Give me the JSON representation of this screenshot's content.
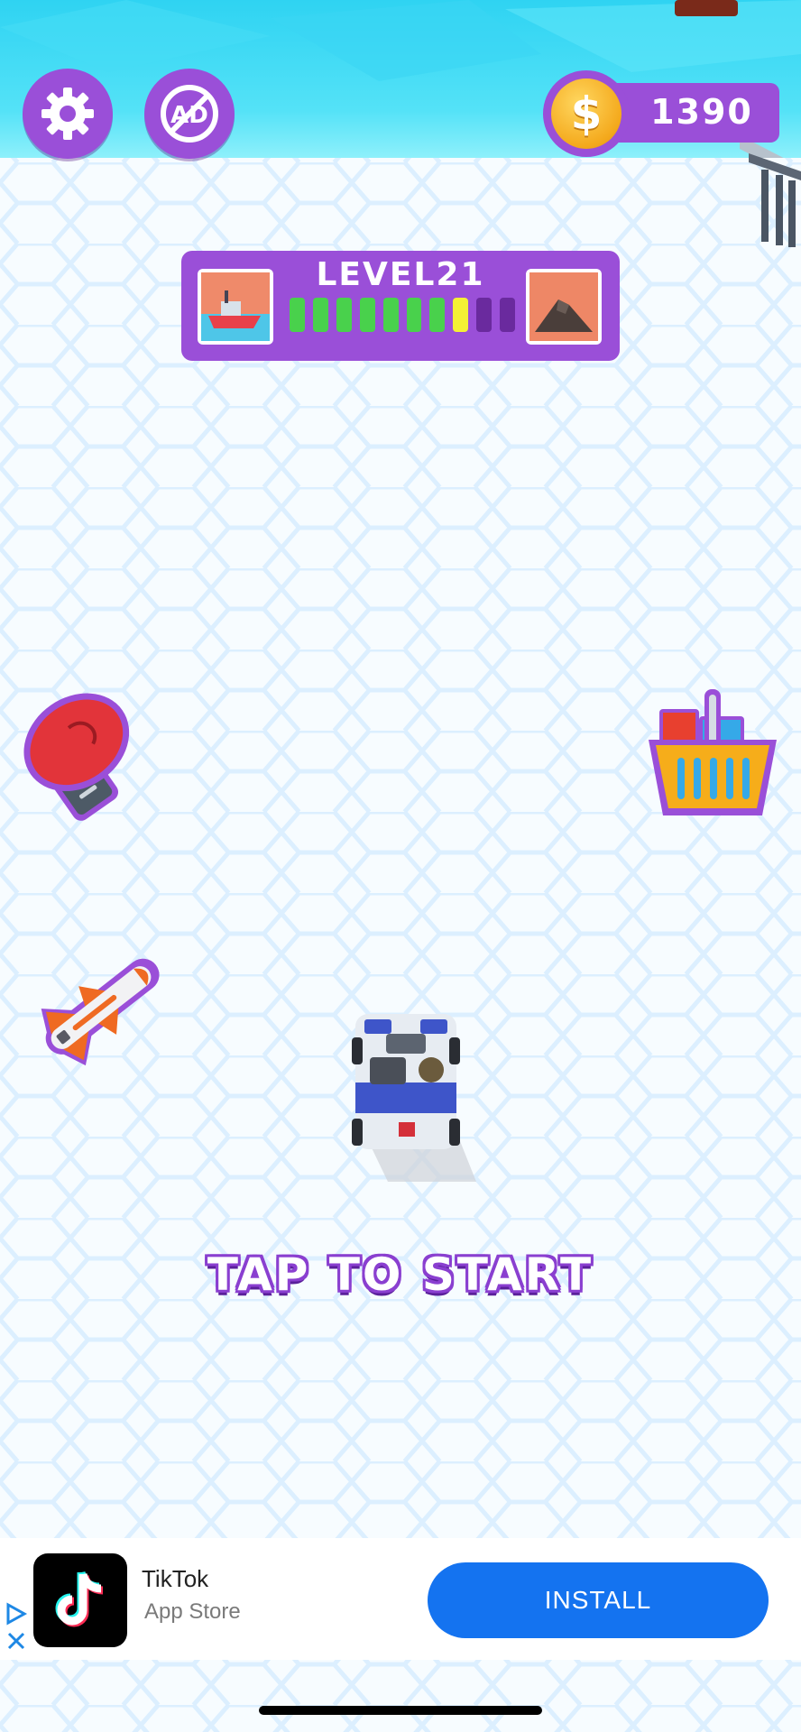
{
  "hud": {
    "coins": "1390",
    "coin_symbol": "$",
    "settings_icon": "gear-icon",
    "no_ads_label": "AD",
    "no_ads_icon": "no-ads-icon"
  },
  "level": {
    "title": "LEVEL21",
    "progress_completed": 7,
    "progress_current": 1,
    "progress_total": 10,
    "colors": {
      "done": "#49d14c",
      "current": "#f4f135",
      "remaining": "#6a2a9e"
    }
  },
  "items": {
    "left_top": "boxing-glove-icon",
    "left_bottom": "rocket-icon",
    "right": "shop-basket-icon",
    "player": "car-icon"
  },
  "prompt": "TAP TO START",
  "ad": {
    "app_name": "TikTok",
    "store": "App Store",
    "install_label": "INSTALL"
  },
  "colors": {
    "accent": "#9a4fd8",
    "water": "#2fd3f2",
    "install": "#1473f0"
  }
}
